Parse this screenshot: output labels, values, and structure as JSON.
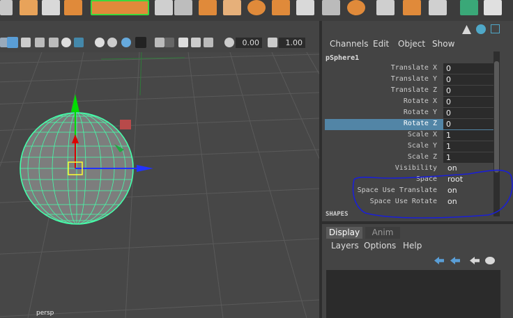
{
  "viewport": {
    "camera_label": "persp",
    "toolbar": {
      "field_1": "0.00",
      "field_2": "1.00"
    },
    "manipulator_colors": {
      "x_axis": "#2233ff",
      "y_axis": "#00dd00",
      "z_axis": "#dd0000",
      "wireframe": "#44ffaa"
    }
  },
  "channel_box": {
    "menu": [
      "Channels",
      "Edit",
      "Object",
      "Show"
    ],
    "object_name": "pSphere1",
    "attributes": [
      {
        "label": "Translate X",
        "value": "0"
      },
      {
        "label": "Translate Y",
        "value": "0"
      },
      {
        "label": "Translate Z",
        "value": "0"
      },
      {
        "label": "Rotate X",
        "value": "0"
      },
      {
        "label": "Rotate Y",
        "value": "0"
      },
      {
        "label": "Rotate Z",
        "value": "0",
        "selected": true
      },
      {
        "label": "Scale X",
        "value": "1"
      },
      {
        "label": "Scale Y",
        "value": "1"
      },
      {
        "label": "Scale Z",
        "value": "1"
      },
      {
        "label": "Visibility",
        "value": "on"
      }
    ],
    "custom_attributes": [
      {
        "label": "Space",
        "value": "root"
      },
      {
        "label": "Space Use Translate",
        "value": "on"
      },
      {
        "label": "Space Use Rotate",
        "value": "on"
      }
    ],
    "shapes_header": "SHAPES",
    "highlight_color": "#5285a6"
  },
  "layer_editor": {
    "tabs": [
      "Display",
      "Anim"
    ],
    "menu": [
      "Layers",
      "Options",
      "Help"
    ]
  },
  "annotation": {
    "color": "#1a1fd6"
  }
}
